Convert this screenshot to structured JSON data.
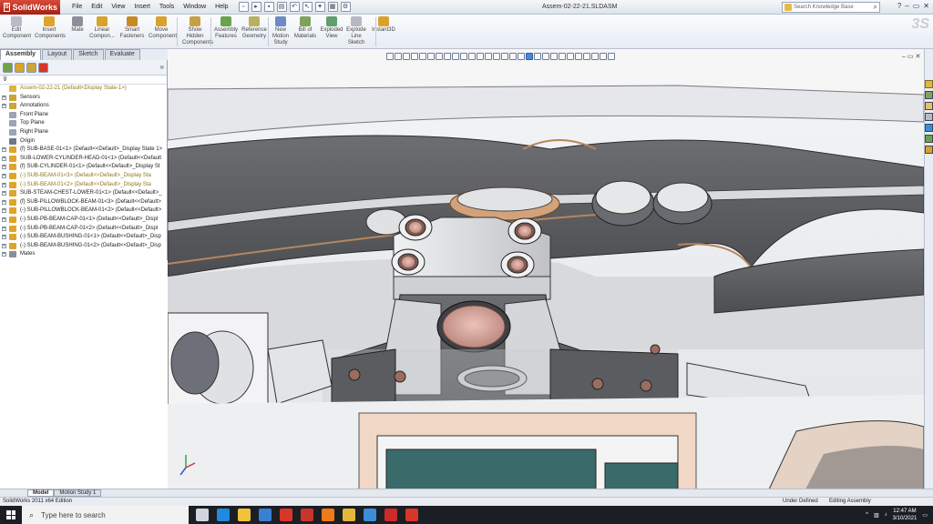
{
  "app": {
    "brand": "SolidWorks",
    "document_title": "Assem-02-22-21.SLDASM",
    "search_placeholder": "Search Knowledge Base"
  },
  "menu": [
    "File",
    "Edit",
    "View",
    "Insert",
    "Tools",
    "Window",
    "Help"
  ],
  "ribbon": [
    {
      "label": "Edit Component",
      "icon": "edit-component-icon",
      "color": "#b7bcc6"
    },
    {
      "label": "Insert Components",
      "icon": "insert-components-icon",
      "color": "#e0a42a"
    },
    {
      "label": "Mate",
      "icon": "mate-icon",
      "color": "#8a8f9a"
    },
    {
      "label": "Linear Compon...",
      "icon": "linear-pattern-icon",
      "color": "#d9a22a"
    },
    {
      "label": "Smart Fasteners",
      "icon": "smart-fasteners-icon",
      "color": "#c88a24"
    },
    {
      "label": "Move Component",
      "icon": "move-component-icon",
      "color": "#d9a22a"
    },
    {
      "label": "Show Hidden Components",
      "icon": "show-hidden-icon",
      "color": "#c7a043"
    },
    {
      "label": "Assembly Features",
      "icon": "assembly-features-icon",
      "color": "#6aa34a"
    },
    {
      "label": "Reference Geometry",
      "icon": "reference-geometry-icon",
      "color": "#b9b060"
    },
    {
      "label": "New Motion Study",
      "icon": "motion-study-icon",
      "color": "#6c8ac8"
    },
    {
      "label": "Bill of Materials",
      "icon": "bom-icon",
      "color": "#7fa35a"
    },
    {
      "label": "Exploded View",
      "icon": "exploded-view-icon",
      "color": "#5fa06c"
    },
    {
      "label": "Explode Line Sketch",
      "icon": "explode-line-icon",
      "color": "#b4bac4"
    },
    {
      "label": "Instant3D",
      "icon": "instant3d-icon",
      "color": "#d9a22a"
    }
  ],
  "command_tabs": [
    "Assembly",
    "Layout",
    "Sketch",
    "Evaluate"
  ],
  "tree": [
    {
      "label": "Assem-02-22-21  (Default<Display State-1>)",
      "kind": "root",
      "color": "#e3b23c"
    },
    {
      "label": "Sensors",
      "kind": "child",
      "color": "#c9a53a"
    },
    {
      "label": "Annotations",
      "kind": "child",
      "color": "#c9a53a"
    },
    {
      "label": "Front Plane",
      "kind": "child",
      "color": "#9aa4b4"
    },
    {
      "label": "Top Plane",
      "kind": "child",
      "color": "#9aa4b4"
    },
    {
      "label": "Right Plane",
      "kind": "child",
      "color": "#9aa4b4"
    },
    {
      "label": "Origin",
      "kind": "child",
      "color": "#6b7a8a"
    },
    {
      "label": "(f) SUB-BASE-01<1> (Default<<Default>_Display State 1>",
      "kind": "part",
      "color": "#e0a42a"
    },
    {
      "label": "SUB-LOWER-CYLINDER-HEAD-01<1> (Default<<Default",
      "kind": "part",
      "color": "#e0a42a"
    },
    {
      "label": "(f) SUB-CYLINDER-01<1> (Default<<Default>_Display St",
      "kind": "part",
      "color": "#e0a42a"
    },
    {
      "label": "(-) SUB-BEAM-01<3> (Default<<Default>_Display Sta",
      "kind": "warn",
      "color": "#e0a42a"
    },
    {
      "label": "(-) SUB-BEAM-01<2> (Default<<Default>_Display Sta",
      "kind": "warn",
      "color": "#e0a42a"
    },
    {
      "label": "SUB-STEAM-CHEST-LOWER-01<1> (Default<<Default>_",
      "kind": "part",
      "color": "#e0a42a"
    },
    {
      "label": "(f) SUB-PILLOWBLOCK-BEAM-01<3> (Default<<Default>",
      "kind": "part",
      "color": "#e0a42a"
    },
    {
      "label": "(-) SUB-PILLOWBLOCK-BEAM-01<2> (Default<<Default>",
      "kind": "part",
      "color": "#e0a42a"
    },
    {
      "label": "(-) SUB-PB-BEAM-CAP-01<1> (Default<<Default>_Displ",
      "kind": "part",
      "color": "#e0a42a"
    },
    {
      "label": "(-) SUB-PB-BEAM-CAP-01<2> (Default<<Default>_Displ",
      "kind": "part",
      "color": "#e0a42a"
    },
    {
      "label": "(-) SUB-BEAM-BUSHING-01<1> (Default<<Default>_Disp",
      "kind": "part",
      "color": "#e0a42a"
    },
    {
      "label": "(-) SUB-BEAM-BUSHING-01<2> (Default<<Default>_Disp",
      "kind": "part",
      "color": "#e0a42a"
    },
    {
      "label": "Mates",
      "kind": "child",
      "color": "#8a8f9a"
    }
  ],
  "model_tabs": [
    "Model",
    "Motion Study 1"
  ],
  "status": {
    "left": "SolidWorks 2011 x64 Edition",
    "definition": "Under Defined",
    "mode": "Editing Assembly"
  },
  "taskbar": {
    "search_placeholder": "Type here to search",
    "time": "12:47 AM",
    "date": "3/10/2021",
    "apps": [
      {
        "icon": "task-view-icon",
        "color": "#cfd6e0"
      },
      {
        "icon": "edge-icon",
        "color": "#1f8ae0"
      },
      {
        "icon": "file-explorer-icon",
        "color": "#f0c23a"
      },
      {
        "icon": "mail-icon",
        "color": "#3a7fd4"
      },
      {
        "icon": "solidworks-app-icon",
        "color": "#d7362a"
      },
      {
        "icon": "app-icon-red",
        "color": "#c8352a"
      },
      {
        "icon": "firefox-icon",
        "color": "#f07a1a"
      },
      {
        "icon": "app-icon-yellow",
        "color": "#e5b63a"
      },
      {
        "icon": "app-icon-blue",
        "color": "#3c8fd6"
      },
      {
        "icon": "acrobat-icon",
        "color": "#cf2a2a"
      },
      {
        "icon": "solidworks-active-icon",
        "color": "#d7362a"
      }
    ]
  },
  "colors": {
    "model_gray": "#5f6064",
    "model_light": "#d9dadc",
    "bronze": "#b5875d",
    "bushing_pink": "#d5a7a0"
  }
}
